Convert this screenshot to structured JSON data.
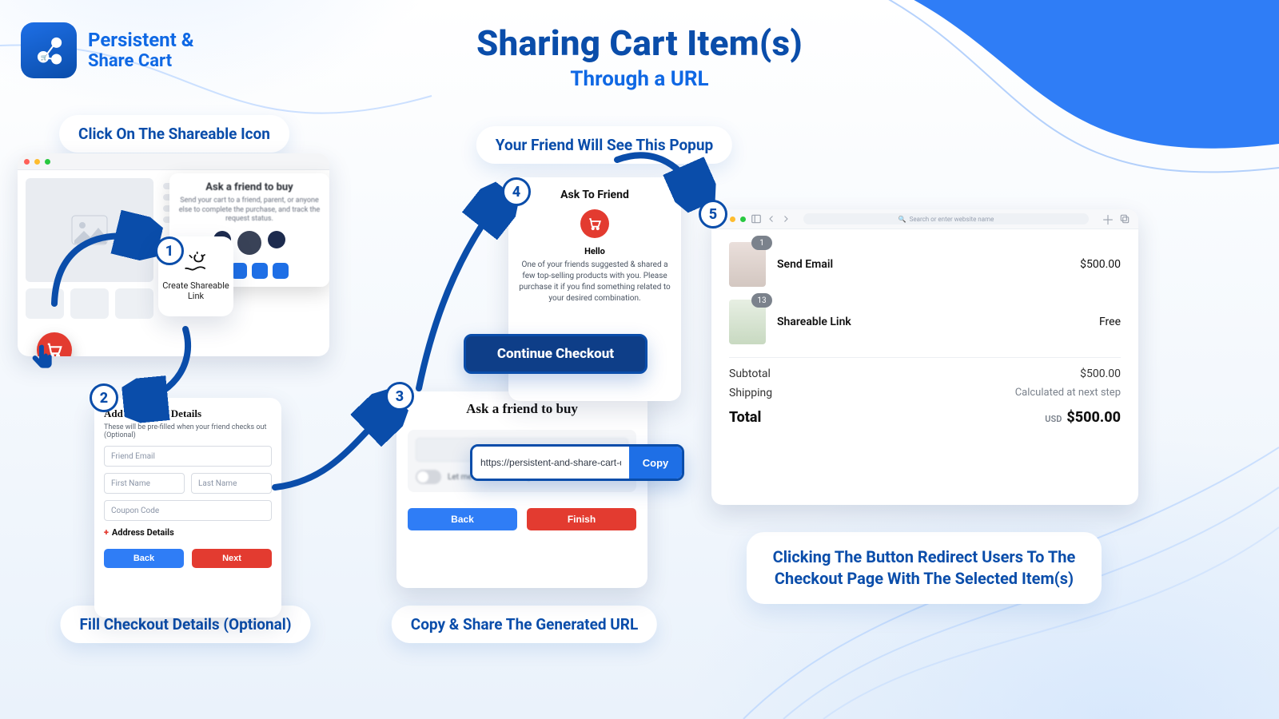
{
  "brand": {
    "line1": "Persistent &",
    "line2": "Share Cart"
  },
  "heading": {
    "title": "Sharing Cart Item(s)",
    "subtitle": "Through a URL"
  },
  "pills": {
    "p1": "Click On The Shareable Icon",
    "p2": "Fill Checkout Details (Optional)",
    "p3": "Copy & Share The Generated URL",
    "p4": "Your Friend Will See This Popup",
    "p5": "Clicking The Button Redirect Users To The Checkout Page With The Selected Item(s)"
  },
  "steps": {
    "s1": "1",
    "s2": "2",
    "s3": "3",
    "s4": "4",
    "s5": "5"
  },
  "panel1": {
    "popup_title": "Ask a friend to buy",
    "popup_text": "Send your cart to a friend, parent, or anyone else to complete the purchase, and track the request status.",
    "tile_label": "Create Shareable Link"
  },
  "panel2": {
    "title": "Add Checkout Details",
    "note": "These will be pre-filled when your friend checks out (Optional)",
    "friend_email_ph": "Friend Email",
    "first_name_ph": "First Name",
    "last_name_ph": "Last Name",
    "coupon_ph": "Coupon Code",
    "address_label": "Address Details",
    "back": "Back",
    "next": "Next"
  },
  "panel3": {
    "title": "Ask a friend to buy",
    "url_value": "https://persistent-and-share-cart-de",
    "copy": "Copy",
    "toggle_label": "Let me know once the purchase has been made",
    "back": "Back",
    "finish": "Finish"
  },
  "panel4": {
    "title": "Ask To Friend",
    "hello": "Hello",
    "desc": "One of your friends suggested & shared a few top-selling products with you. Please purchase it if you find something related to your desired combination.",
    "cta": "Continue Checkout"
  },
  "panel5": {
    "search_ph": "Search or enter website name",
    "items": [
      {
        "badge": "1",
        "name": "Send Email",
        "price": "$500.00"
      },
      {
        "badge": "13",
        "name": "Shareable Link",
        "price": "Free"
      }
    ],
    "subtotal_label": "Subtotal",
    "subtotal_value": "$500.00",
    "shipping_label": "Shipping",
    "shipping_value": "Calculated at next step",
    "total_label": "Total",
    "total_currency": "USD",
    "total_value": "$500.00"
  }
}
